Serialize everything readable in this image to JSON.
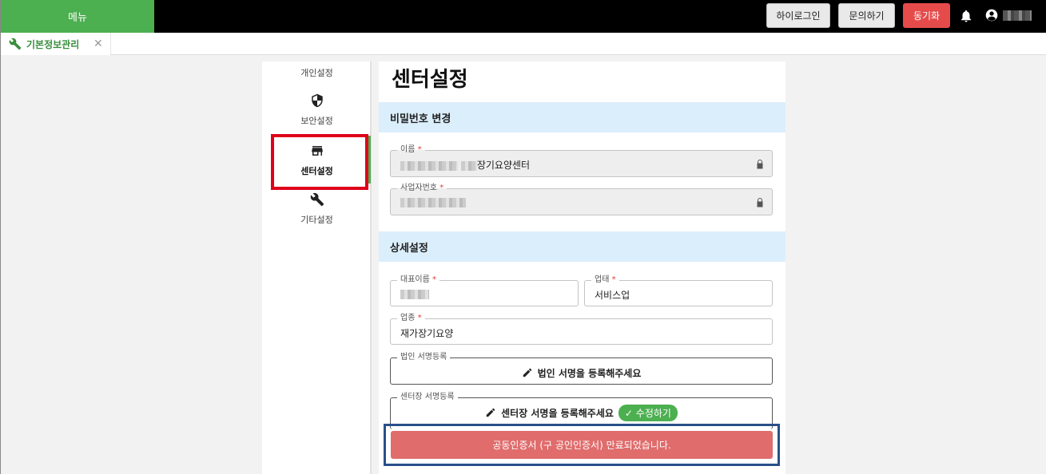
{
  "topbar": {
    "menu_label": "메뉴",
    "buttons": {
      "high_login": "하이로그인",
      "inquiry": "문의하기",
      "sync": "동기화"
    },
    "colors": {
      "menu_bg": "#4caf50",
      "sync_bg": "#e54b4b",
      "bar_bg": "#000000"
    }
  },
  "tab": {
    "label": "기본정보관리"
  },
  "sidebar": {
    "items": [
      {
        "label": "개인설정"
      },
      {
        "label": "보안설정",
        "icon": "shield-icon"
      },
      {
        "label": "센터설정",
        "icon": "store-icon",
        "active": true
      },
      {
        "label": "기타설정",
        "icon": "wrench-icon"
      }
    ]
  },
  "main": {
    "title": "센터설정",
    "password_section": "비밀번호 변경",
    "name_field": {
      "label": "이름",
      "required": "*",
      "value_suffix": "장기요양센터"
    },
    "bizno_field": {
      "label": "사업자번호",
      "required": "*"
    },
    "detail_section": "상세설정",
    "rep_field": {
      "label": "대표이름",
      "required": "*"
    },
    "biz_type_field": {
      "label": "업태",
      "required": "*",
      "value": "서비스업"
    },
    "biz_item_field": {
      "label": "업종",
      "required": "*",
      "value": "재가장기요양"
    },
    "corp_sign": {
      "label": "법인 서명등록",
      "button": "법인 서명을 등록해주세요"
    },
    "center_sign": {
      "label": "센터장 서명등록",
      "button": "센터장 서명을 등록해주세요",
      "edit_badge": "✓ 수정하기"
    },
    "expired_message": "공동인증서 (구 공인인증서) 만료되었습니다."
  }
}
